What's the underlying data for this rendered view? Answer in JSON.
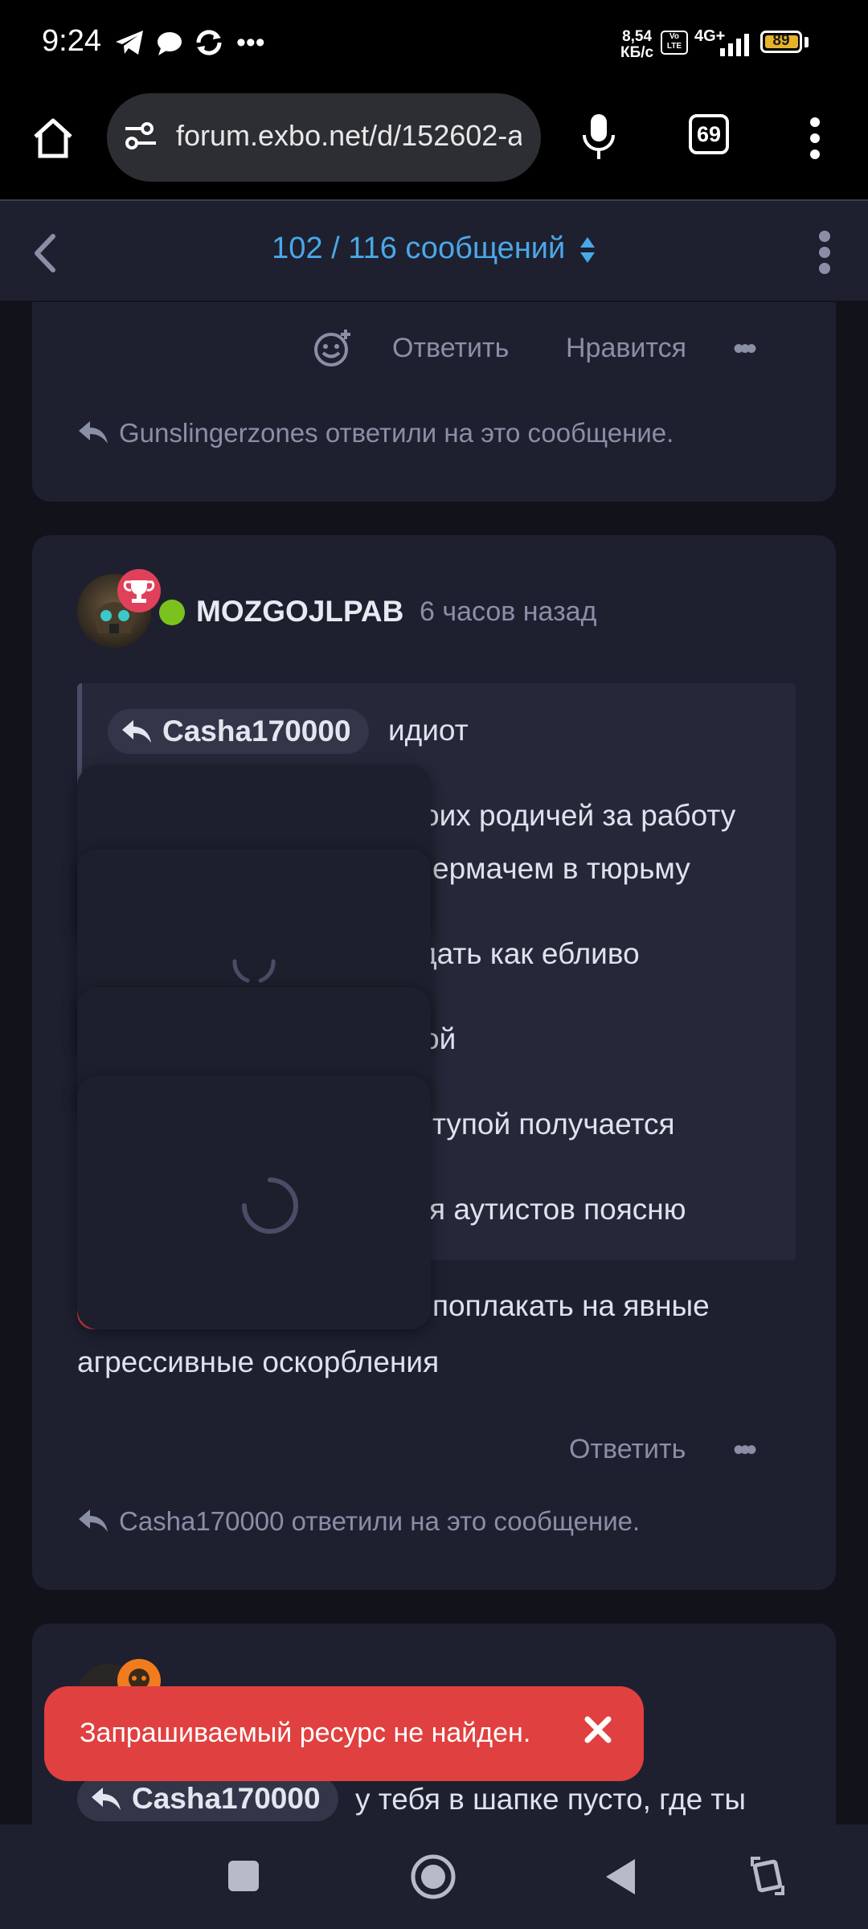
{
  "status": {
    "time": "9:24",
    "net_speed_value": "8,54",
    "net_speed_unit": "КБ/с",
    "volte": "Vo LTE",
    "network": "4G+",
    "battery": "89"
  },
  "browser": {
    "url": "forum.exbo.net/d/152602-a",
    "tabs_count": "69"
  },
  "discussion": {
    "post_counter": "102 / 116 сообщений"
  },
  "post_prev": {
    "actions": {
      "reply": "Ответить",
      "like": "Нравится",
      "more": "•••"
    },
    "replies_note": "Gunslingerzones ответили на это сообщение."
  },
  "post_main": {
    "username": "MOZGOJLPAB",
    "time": "6 часов назад",
    "quote_mention": "Casha170000",
    "quote_first": "идиот",
    "quote_lines": [
      "оих родичей за работу",
      "ермачем в тюрьму",
      "дать как ебливо",
      "ой",
      "тупой получается",
      "я аутистов поясню"
    ],
    "body_line1": "поплакать на явные",
    "body_line2": "агрессивные оскорбления",
    "actions": {
      "reply": "Ответить",
      "more": "•••"
    },
    "replies_note": "Casha170000 ответили на это сообщение."
  },
  "post_next": {
    "mention": "Casha170000",
    "text": "у тебя в шапке пусто, где ты"
  },
  "toast": {
    "message": "Запрашиваемый ресурс не найден."
  },
  "colors": {
    "accent": "#4aa8e8",
    "online": "#7cc21e",
    "badge": "#e0405a",
    "toast": "#e0403f",
    "card": "#1e2030",
    "page": "#12131a"
  }
}
